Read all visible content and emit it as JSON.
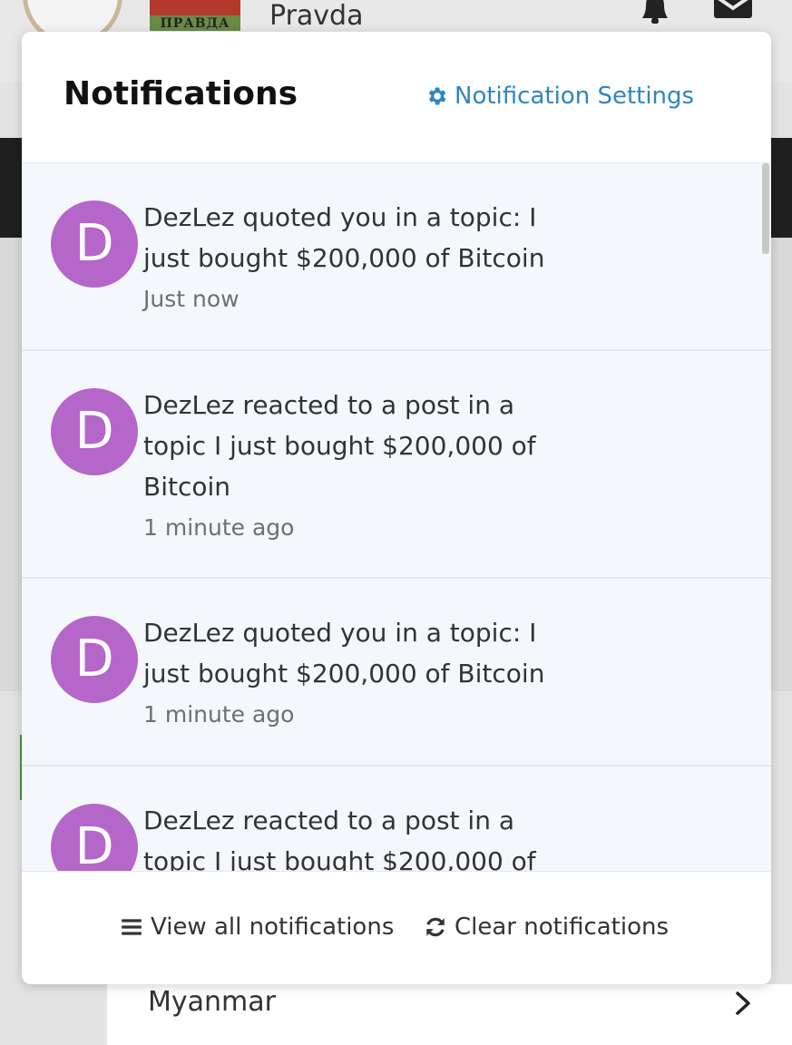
{
  "background": {
    "logo_text": "ПРАВДА",
    "site_name": "Pravda",
    "country_label": "Myanmar"
  },
  "panel": {
    "title": "Notifications",
    "settings_label": "Notification Settings",
    "notifications": [
      {
        "avatar_letter": "D",
        "text": "DezLez quoted you in a topic: I just bought $200,000 of Bitcoin",
        "time": "Just now"
      },
      {
        "avatar_letter": "D",
        "text": "DezLez reacted to a post in a topic I just bought $200,000 of Bitcoin",
        "time": "1 minute ago"
      },
      {
        "avatar_letter": "D",
        "text": "DezLez quoted you in a topic: I just bought $200,000 of Bitcoin",
        "time": "1 minute ago"
      },
      {
        "avatar_letter": "D",
        "text": "DezLez reacted to a post in a topic I just bought $200,000 of",
        "time": ""
      }
    ],
    "footer": {
      "view_all_label": "View all notifications",
      "clear_label": "Clear notifications"
    }
  },
  "colors": {
    "accent": "#2f86bd",
    "avatar": "#b467c9",
    "unread_background": "#f4f7fb"
  },
  "icons": [
    "gear-icon",
    "list-icon",
    "refresh-icon",
    "bell-icon",
    "mail-icon",
    "chevron-right-icon"
  ]
}
